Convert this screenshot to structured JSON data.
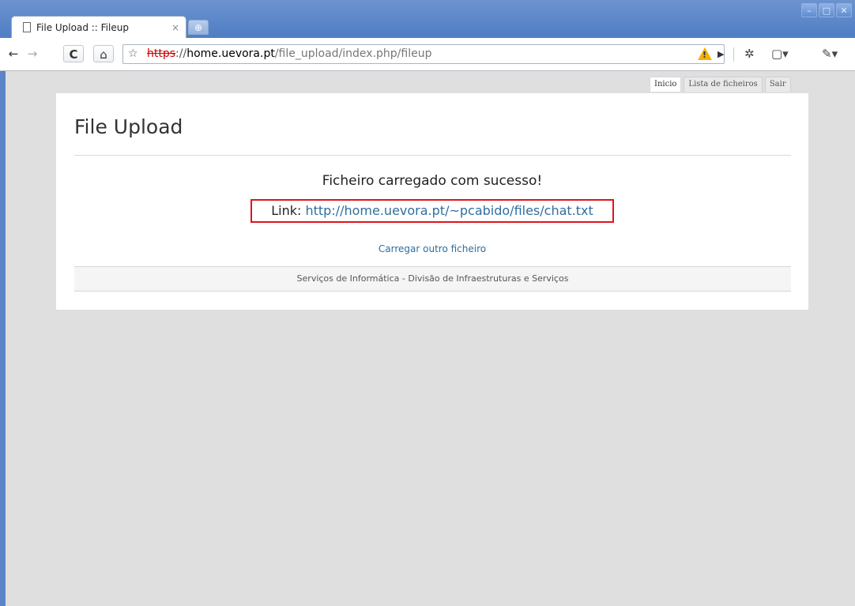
{
  "browser": {
    "tab_title": "File Upload :: Fileup",
    "tab_close": "×",
    "new_tab": "⊕",
    "window_controls": [
      "–",
      "□",
      "✕"
    ],
    "url": {
      "scheme": "https",
      "separator": "://",
      "host": "home.uevora.pt",
      "path": "/file_upload/index.php/fileup"
    }
  },
  "site_tabs": [
    "Inicio",
    "Lista de ficheiros",
    "Sair"
  ],
  "page": {
    "title": "File Upload",
    "message": "Ficheiro carregado com sucesso!",
    "link_label": "Link:",
    "link_url": "http://home.uevora.pt/~pcabido/files/chat.txt",
    "another_link": "Carregar outro ficheiro",
    "footer": "Serviços de Informática - Divisão de Infraestruturas e Serviços"
  },
  "colors": {
    "link": "#2e6e9e",
    "highlight_border": "#e0131b",
    "insecure_scheme": "#cc0000"
  }
}
